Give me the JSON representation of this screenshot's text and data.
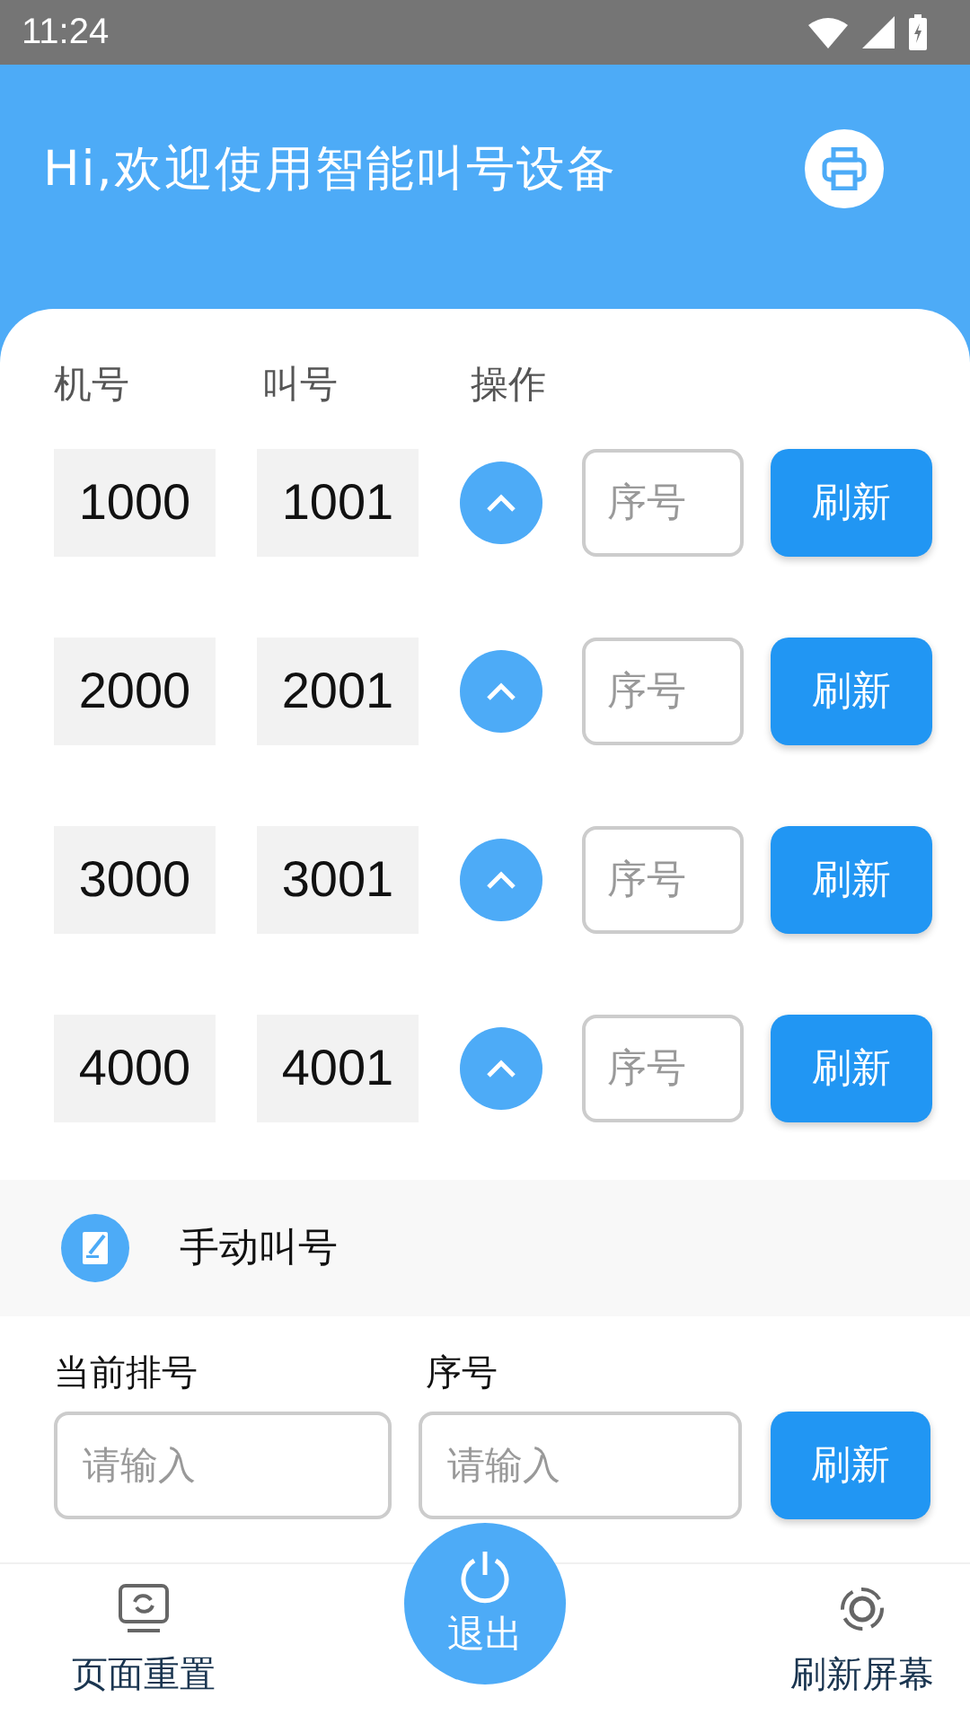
{
  "status_bar": {
    "time": "11:24"
  },
  "header": {
    "title": "Hi,欢迎使用智能叫号设备"
  },
  "table": {
    "columns": [
      "机号",
      "叫号",
      "操作"
    ],
    "rows": [
      {
        "machine": "1000",
        "number": "1001",
        "placeholder": "序号",
        "button": "刷新"
      },
      {
        "machine": "2000",
        "number": "2001",
        "placeholder": "序号",
        "button": "刷新"
      },
      {
        "machine": "3000",
        "number": "3001",
        "placeholder": "序号",
        "button": "刷新"
      },
      {
        "machine": "4000",
        "number": "4001",
        "placeholder": "序号",
        "button": "刷新"
      }
    ]
  },
  "manual": {
    "title": "手动叫号",
    "fields": [
      {
        "label": "当前排号",
        "placeholder": "请输入"
      },
      {
        "label": "序号",
        "placeholder": "请输入"
      }
    ],
    "button": "刷新"
  },
  "bottom_nav": {
    "items": [
      {
        "kind": "reset",
        "label": "页面重置"
      },
      {
        "kind": "exit",
        "label": "退出"
      },
      {
        "kind": "screen",
        "label": "刷新屏幕"
      }
    ]
  }
}
